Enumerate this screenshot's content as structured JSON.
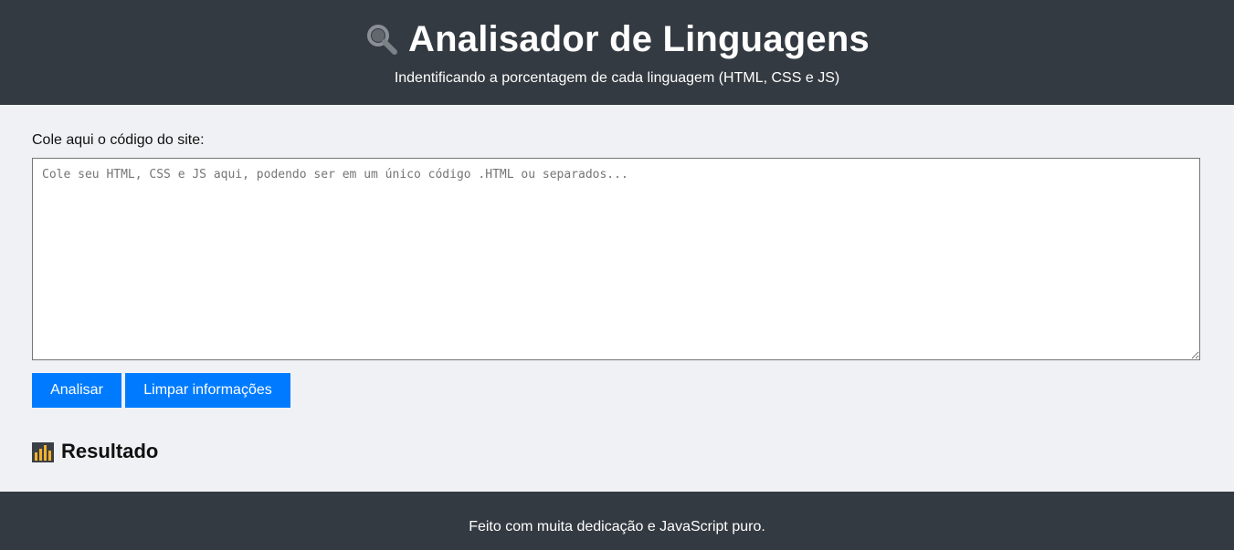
{
  "header": {
    "title": "Analisador de Linguagens",
    "subtitle": "Indentificando a porcentagem de cada linguagem (HTML, CSS e JS)",
    "icon": "magnifier-icon"
  },
  "form": {
    "label": "Cole aqui o código do site:",
    "textarea_value": "",
    "textarea_placeholder": "Cole seu HTML, CSS e JS aqui, podendo ser em um único código .HTML ou separados...",
    "analyze_label": "Analisar",
    "clear_label": "Limpar informações"
  },
  "result": {
    "heading": "Resultado",
    "icon": "bar-chart-icon"
  },
  "footer": {
    "text": "Feito com muita dedicação e JavaScript puro."
  },
  "colors": {
    "header_bg": "#343a41",
    "page_bg": "#f0f1f4",
    "button_bg": "#007bff",
    "footer_bg": "#343a41"
  }
}
